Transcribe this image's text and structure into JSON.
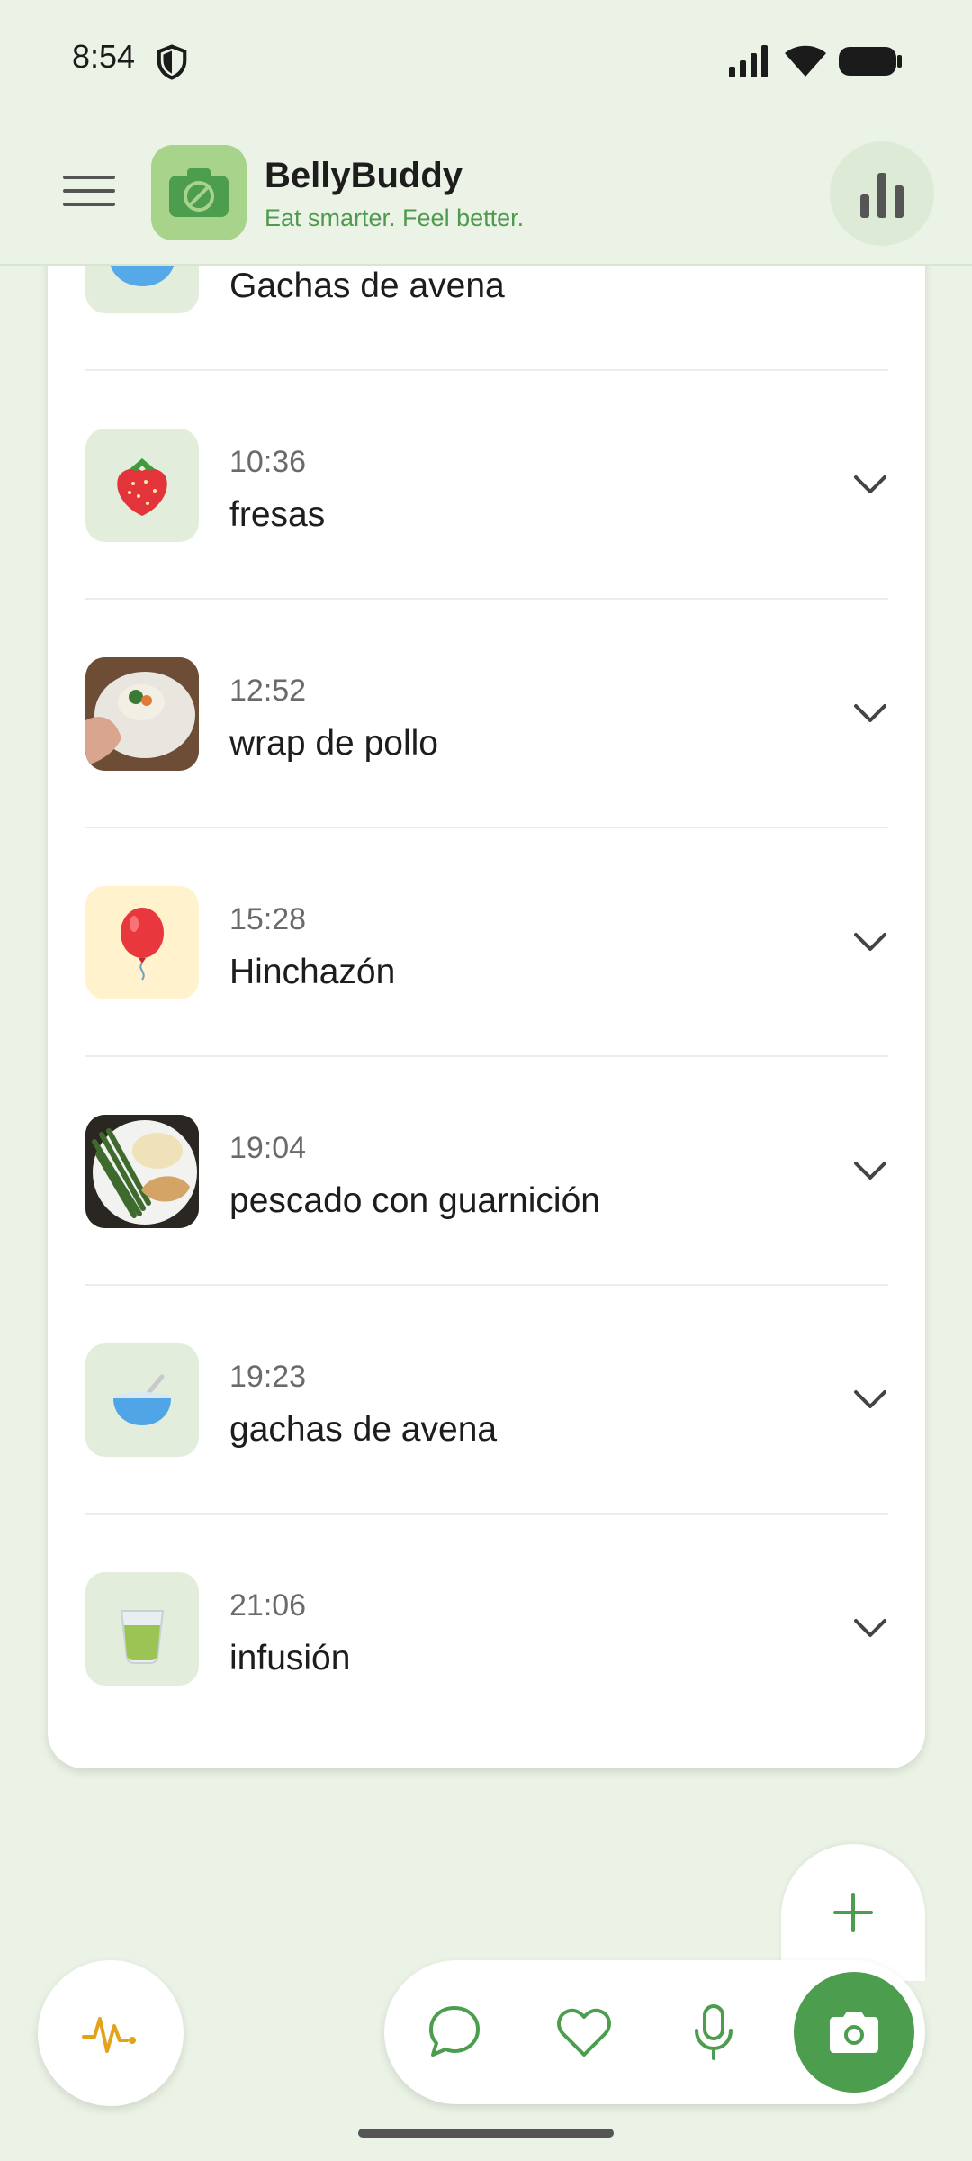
{
  "status_bar": {
    "time": "8:54"
  },
  "app": {
    "title": "BellyBuddy",
    "subtitle": "Eat smarter. Feel better."
  },
  "entries": [
    {
      "time": "",
      "title": "Gachas de avena",
      "thumb": "bowl-icon"
    },
    {
      "time": "10:36",
      "title": "fresas",
      "thumb": "strawberry-icon"
    },
    {
      "time": "12:52",
      "title": "wrap de pollo",
      "thumb": "photo-wrap"
    },
    {
      "time": "15:28",
      "title": "Hinchazón",
      "thumb": "balloon-icon"
    },
    {
      "time": "19:04",
      "title": "pescado con guarnición",
      "thumb": "photo-fish"
    },
    {
      "time": "19:23",
      "title": "gachas de avena",
      "thumb": "bowl-icon"
    },
    {
      "time": "21:06",
      "title": "infusión",
      "thumb": "tea-icon"
    }
  ],
  "colors": {
    "background": "#EBF3E6",
    "accent": "#4C9D4E",
    "logo": "#A7D38B",
    "subtitle": "#4f9a4e",
    "symptom_thumb": "#FFF2CC",
    "food_thumb": "#E2EDDC"
  }
}
